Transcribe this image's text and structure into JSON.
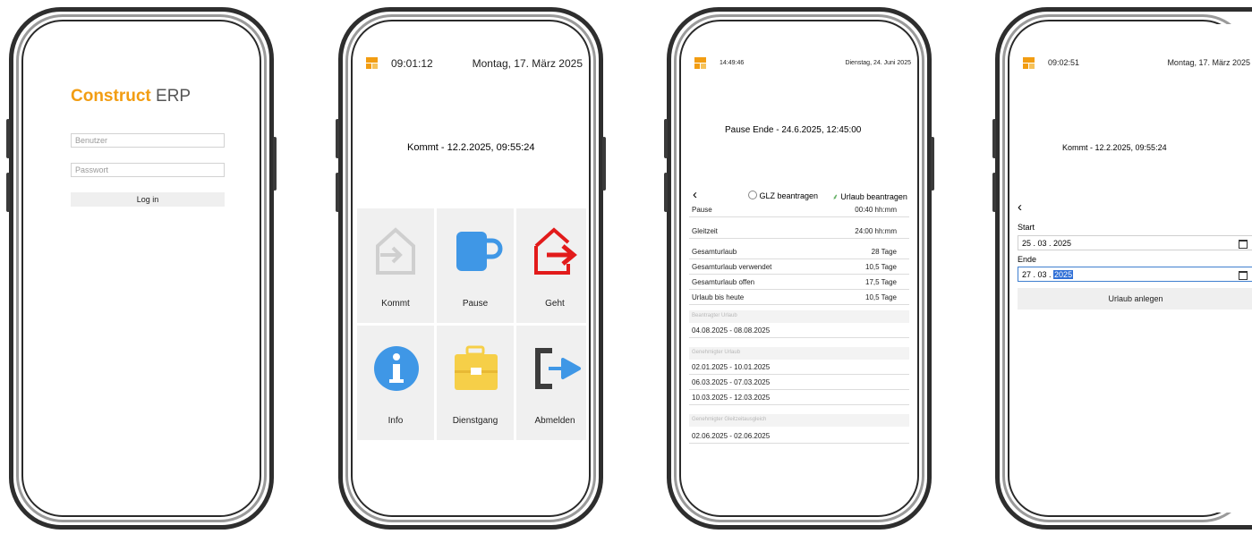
{
  "colors": {
    "brand": "#f29d12",
    "red": "#e21b1b",
    "blue": "#3f97e6",
    "yellow": "#f6cf48",
    "gray_icon": "#cfcfcf",
    "dark_icon": "#3c3c3c"
  },
  "login": {
    "brand_bold": "Construct",
    "brand_light": "ERP",
    "user_placeholder": "Benutzer",
    "pass_placeholder": "Passwort",
    "login_button": "Log in"
  },
  "home": {
    "time": "09:01:12",
    "date": "Montag, 17. März 2025",
    "status_text": "Kommt - 12.2.2025, 09:55:24",
    "tiles": [
      {
        "label": "Kommt",
        "icon": "enter-house-icon"
      },
      {
        "label": "Pause",
        "icon": "cup-icon"
      },
      {
        "label": "Geht",
        "icon": "leave-house-icon"
      },
      {
        "label": "Info",
        "icon": "info-icon"
      },
      {
        "label": "Dienstgang",
        "icon": "briefcase-icon"
      },
      {
        "label": "Abmelden",
        "icon": "logout-icon"
      }
    ]
  },
  "info": {
    "time": "14:49:46",
    "date": "Dienstag, 24. Juni 2025",
    "status_text": "Pause Ende - 24.6.2025, 12:45:00",
    "back": "‹",
    "glz_link": "GLZ beantragen",
    "urlaub_link": "Urlaub beantragen",
    "rows": [
      {
        "label": "Pause",
        "value": "00:40 hh:mm"
      },
      {
        "label": "Gleitzeit",
        "value": "24:00 hh:mm"
      },
      {
        "label": "Gesamturlaub",
        "value": "28 Tage"
      },
      {
        "label": "Gesamturlaub verwendet",
        "value": "10,5 Tage"
      },
      {
        "label": "Gesamturlaub offen",
        "value": "17,5 Tage"
      },
      {
        "label": "Urlaub bis heute",
        "value": "10,5 Tage"
      }
    ],
    "beantragt_header": "Beantragter Urlaub",
    "beantragt": [
      "04.08.2025 - 08.08.2025"
    ],
    "genehmigt_header": "Genehmigter Urlaub",
    "genehmigt": [
      "02.01.2025 - 10.01.2025",
      "06.03.2025 - 07.03.2025",
      "10.03.2025 - 12.03.2025"
    ],
    "gleitzeit_header": "Genehmigter Gleitzeitausgleich",
    "gleitzeit": [
      "02.06.2025 - 02.06.2025"
    ]
  },
  "vacation": {
    "time": "09:02:51",
    "date": "Montag, 17. März 2025",
    "status_text": "Kommt - 12.2.2025, 09:55:24",
    "back": "‹",
    "start_label": "Start",
    "start_value": "25 . 03 . 2025",
    "end_label": "Ende",
    "end_day": "27 . 03 .",
    "end_year": "2025",
    "submit": "Urlaub anlegen"
  }
}
